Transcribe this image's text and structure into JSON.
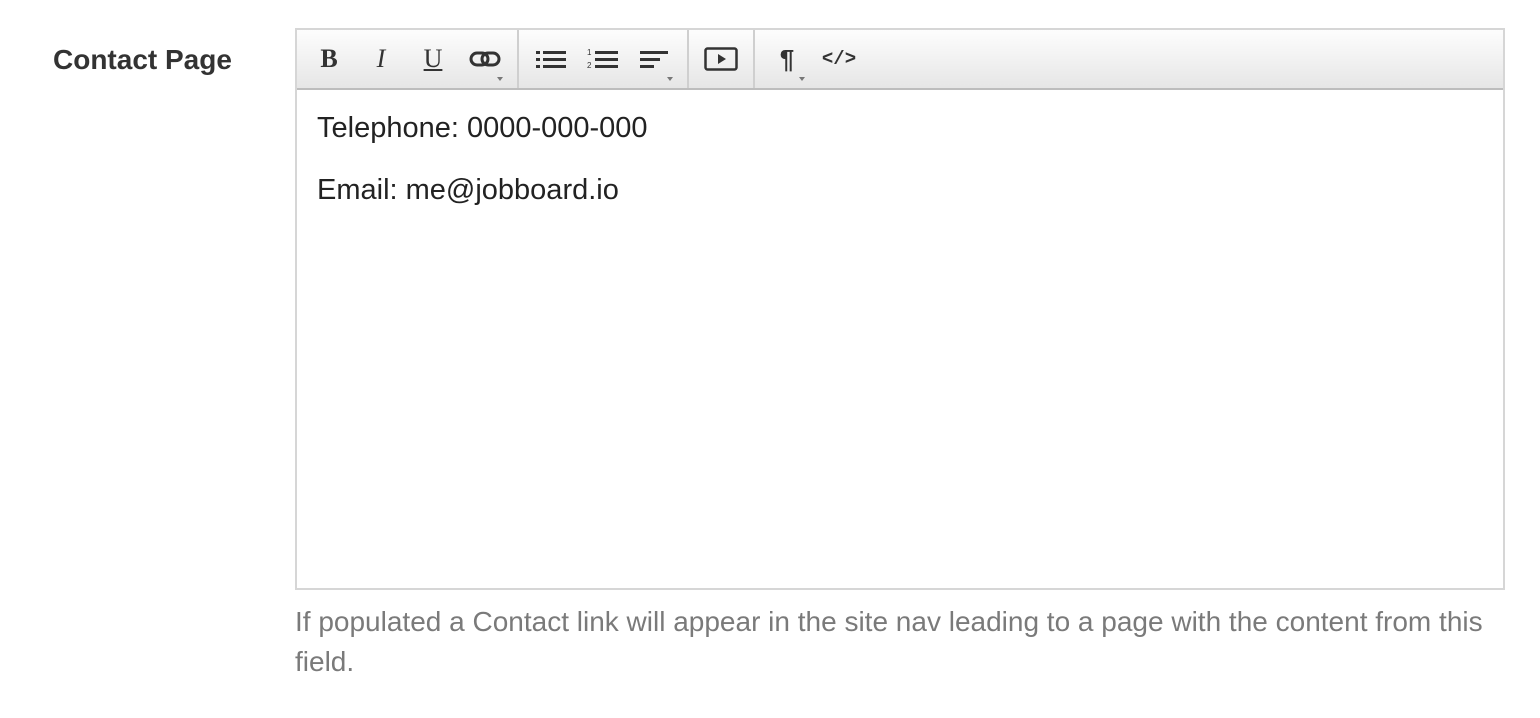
{
  "field": {
    "label": "Contact Page"
  },
  "toolbar": {
    "buttons": [
      {
        "name": "bold-button",
        "icon": "bold-icon",
        "glyph": "B"
      },
      {
        "name": "italic-button",
        "icon": "italic-icon",
        "glyph": "I"
      },
      {
        "name": "underline-button",
        "icon": "underline-icon",
        "glyph": "U"
      },
      {
        "name": "link-button",
        "icon": "link-icon",
        "dropdown": true
      },
      {
        "name": "bulleted-list-button",
        "icon": "bulleted-list-icon"
      },
      {
        "name": "numbered-list-button",
        "icon": "numbered-list-icon"
      },
      {
        "name": "align-button",
        "icon": "align-left-icon",
        "dropdown": true
      },
      {
        "name": "video-button",
        "icon": "video-icon"
      },
      {
        "name": "paragraph-format-button",
        "icon": "pilcrow-icon",
        "glyph": "¶",
        "dropdown": true
      },
      {
        "name": "code-view-button",
        "icon": "code-icon",
        "glyph": "</>"
      }
    ]
  },
  "editor": {
    "lines": [
      "Telephone: 0000-000-000",
      "Email: me@jobboard.io"
    ]
  },
  "help": {
    "text": "If populated a Contact link will appear in the site nav leading to a page with the content from this field."
  },
  "colors": {
    "label_text": "#333333",
    "help_text": "#7a7a7a",
    "border": "#d6d6d6",
    "toolbar_bg": "#eeeeee"
  }
}
